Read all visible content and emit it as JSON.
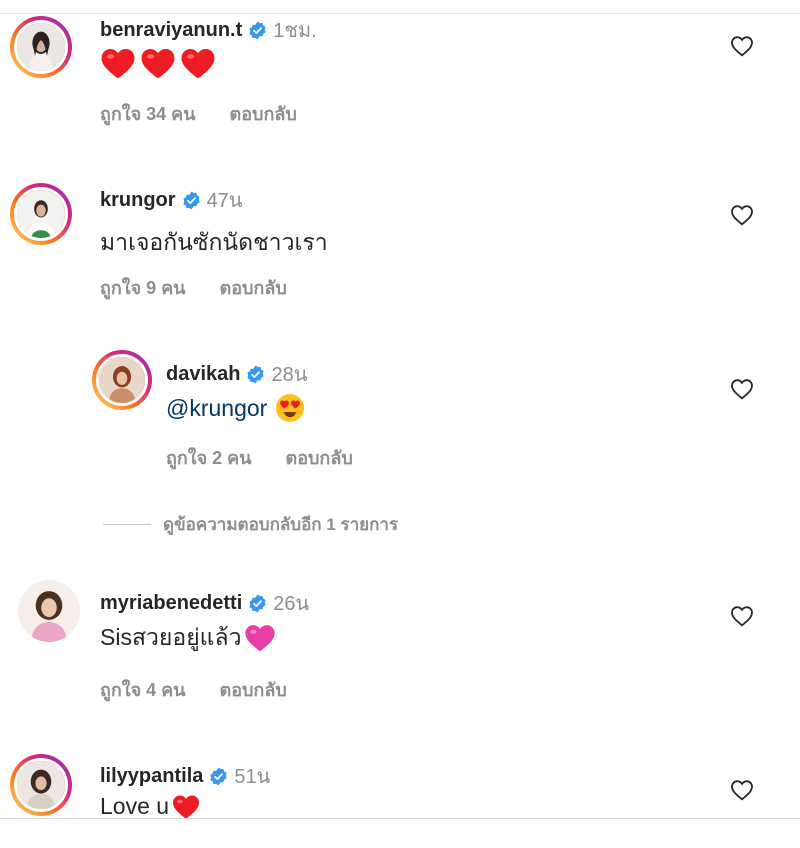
{
  "comments": [
    {
      "username": "benraviyanun.t",
      "time": "1ชม.",
      "text": "",
      "emoji": [
        "red-heart",
        "red-heart",
        "red-heart"
      ],
      "likes": "ถูกใจ 34 คน",
      "reply": "ตอบกลับ"
    },
    {
      "username": "krungor",
      "time": "47น",
      "text": "มาเจอกันซักนัดชาวเรา",
      "likes": "ถูกใจ 9 คน",
      "reply": "ตอบกลับ"
    },
    {
      "username": "davikah",
      "time": "28น",
      "mention": "@krungor",
      "emoji": [
        "heart-eyes-face"
      ],
      "likes": "ถูกใจ 2 คน",
      "reply": "ตอบกลับ"
    },
    {
      "username": "myriabenedetti",
      "time": "26น",
      "text": "Sisสวยอยู่แล้ว",
      "emoji": [
        "pink-heart"
      ],
      "likes": "ถูกใจ 4 คน",
      "reply": "ตอบกลับ"
    },
    {
      "username": "lilyypantila",
      "time": "51น",
      "text": "Love u",
      "emoji": [
        "red-heart"
      ]
    }
  ],
  "view_more_replies": "ดูข้อความตอบกลับอีก 1 รายการ",
  "colors": {
    "verified": "#3897f0",
    "username": "#262626",
    "secondary": "#8e8e8e",
    "mention": "#00376b",
    "heart_red": "#ed1c24",
    "heart_pink": "#e83ea8"
  }
}
